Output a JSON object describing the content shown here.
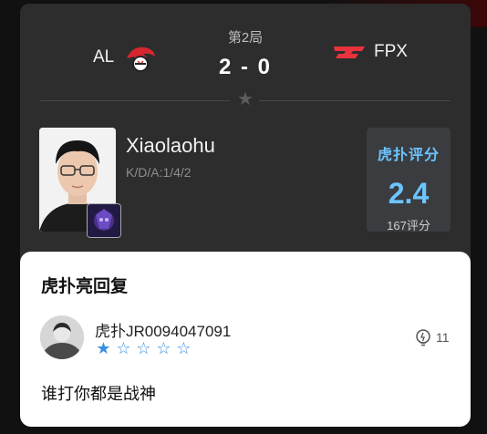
{
  "match": {
    "round": "第2局",
    "score": "2 - 0",
    "left_team": "AL",
    "right_team": "FPX",
    "right_team_logo_text": "FPX"
  },
  "player": {
    "name": "Xiaolaohu",
    "kda": "K/D/A:1/4/2"
  },
  "rating": {
    "title": "虎扑评分",
    "value": "2.4",
    "count": "167评分"
  },
  "reply_sheet": {
    "title": "虎扑亮回复",
    "username": "虎扑JR0094047091",
    "star_rating": 1,
    "star_max": 5,
    "likes": "11",
    "comment": "谁打你都是战神"
  },
  "colors": {
    "accent_blue": "#6cc4ff",
    "star_blue": "#3a8fe0",
    "fpx_red": "#e8323c"
  },
  "icons": {
    "divider_mark": "star-icon",
    "likes": "lightbulb-icon"
  }
}
